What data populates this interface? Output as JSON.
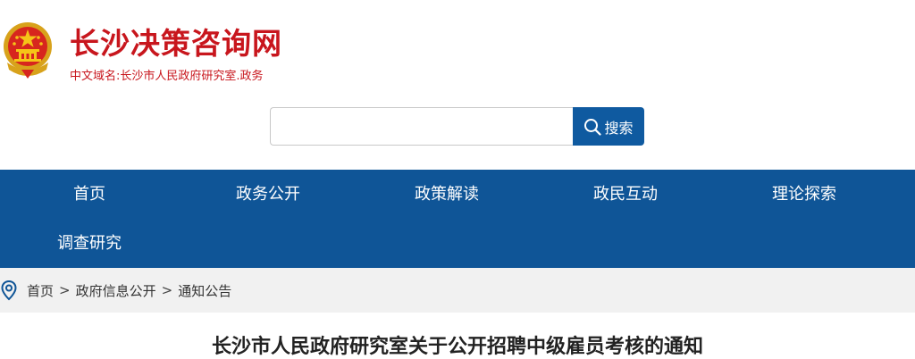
{
  "header": {
    "title": "长沙决策咨询网",
    "domain": "中文域名:长沙市人民政府研究室.政务"
  },
  "search": {
    "placeholder": "",
    "button_label": "搜索"
  },
  "nav": {
    "items": [
      "首页",
      "政务公开",
      "政策解读",
      "政民互动",
      "理论探索",
      "调查研究"
    ]
  },
  "breadcrumb": {
    "items": [
      "首页",
      "政府信息公开",
      "通知公告"
    ],
    "separator": ">"
  },
  "article": {
    "title": "长沙市人民政府研究室关于公开招聘中级雇员考核的通知"
  },
  "colors": {
    "brand_red": "#c8161d",
    "nav_blue": "#0f5597",
    "search_button_blue": "#0f5aa0",
    "breadcrumb_bg": "#f1f1f1"
  },
  "icons": {
    "emblem": "national-emblem-icon",
    "search": "search-icon",
    "location": "location-pin-icon"
  }
}
